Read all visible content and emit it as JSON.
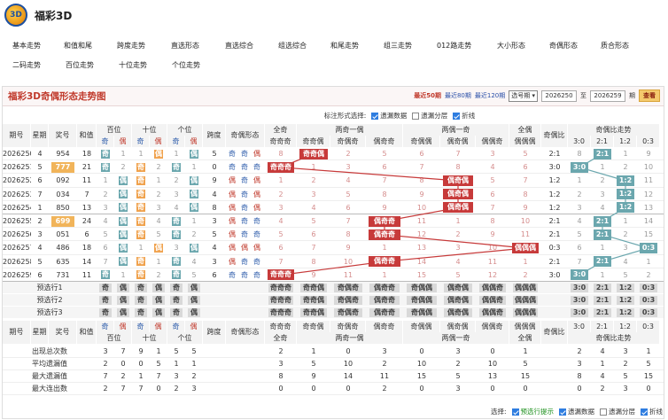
{
  "app": {
    "title": "福彩3D",
    "logo_text": "3D"
  },
  "nav": {
    "row1": [
      "基本走势",
      "和值和尾",
      "跨度走势",
      "直选形态",
      "直选综合",
      "组选综合",
      "和尾走势",
      "组三走势",
      "012路走势",
      "大小形态",
      "奇偶形态",
      "质合形态"
    ],
    "row2": [
      "二码走势",
      "百位走势",
      "十位走势",
      "个位走势"
    ]
  },
  "panel": {
    "title": "福彩3D奇偶形态走势图",
    "links": [
      "最近50期",
      "最近80期",
      "最近120期"
    ],
    "select": "选号期",
    "from": "2026250",
    "to_label": "至",
    "to": "2026259",
    "period_label": "期",
    "query": "查看"
  },
  "options": {
    "label": "标注形式选择:",
    "items": [
      {
        "label": "遗漏数据",
        "checked": true
      },
      {
        "label": "遗漏分层",
        "checked": false
      },
      {
        "label": "折线",
        "checked": true
      }
    ]
  },
  "headers": {
    "issue": "期号",
    "week": "星期",
    "prize": "奖号",
    "sum": "和值",
    "pos": [
      "百位",
      "十位",
      "个位"
    ],
    "span": "跨度",
    "shape": "奇偶形态",
    "groups": [
      "全奇",
      "两奇一偶",
      "两偶一奇",
      "全偶"
    ],
    "ratio": "奇偶比",
    "trend": "奇偶比走势"
  },
  "subheaders": {
    "oe": [
      "奇",
      "偶"
    ],
    "shape_cols": [
      "奇奇奇",
      "奇奇偶",
      "奇偶奇",
      "偶奇奇",
      "奇偶偶",
      "偶奇偶",
      "偶偶奇",
      "偶偶偶"
    ],
    "ratios": [
      "3:0",
      "2:1",
      "1:2",
      "0:3"
    ]
  },
  "rows": [
    {
      "issue": "2026250",
      "week": "4",
      "prize": "954",
      "sum": "18",
      "pos": [
        "奇",
        "1",
        "偶",
        "1",
        "偶",
        "1"
      ],
      "span": "5",
      "shape": [
        "奇",
        "奇",
        "偶"
      ],
      "cols": [
        "8",
        "奇奇偶",
        "2",
        "5",
        "6",
        "7",
        "3",
        "5"
      ],
      "ratio": "2:1",
      "trend": [
        "8",
        "2:1",
        "1",
        "9"
      ]
    },
    {
      "issue": "2026251",
      "week": "5",
      "prize": "777",
      "sum": "21",
      "pos": [
        "奇",
        "2",
        "奇",
        "2",
        "奇",
        "1"
      ],
      "span": "0",
      "shape": [
        "奇",
        "奇",
        "奇"
      ],
      "cols": [
        "奇奇奇",
        "1",
        "3",
        "6",
        "7",
        "8",
        "4",
        "6"
      ],
      "ratio": "3:0",
      "trend": [
        "3:0",
        "1",
        "2",
        "10"
      ]
    },
    {
      "issue": "2026252",
      "week": "6",
      "prize": "092",
      "sum": "11",
      "pos": [
        "偶",
        "1",
        "奇",
        "1",
        "偶",
        "2"
      ],
      "span": "9",
      "shape": [
        "偶",
        "奇",
        "偶"
      ],
      "cols": [
        "1",
        "2",
        "4",
        "7",
        "8",
        "偶奇偶",
        "5",
        "7"
      ],
      "ratio": "1:2",
      "trend": [
        "1",
        "2",
        "1:2",
        "11"
      ]
    },
    {
      "issue": "2026253",
      "week": "7",
      "prize": "034",
      "sum": "7",
      "pos": [
        "偶",
        "2",
        "奇",
        "2",
        "偶",
        "3"
      ],
      "span": "4",
      "shape": [
        "偶",
        "奇",
        "偶"
      ],
      "cols": [
        "2",
        "3",
        "5",
        "8",
        "9",
        "偶奇偶",
        "6",
        "8"
      ],
      "ratio": "1:2",
      "trend": [
        "2",
        "3",
        "1:2",
        "12"
      ]
    },
    {
      "issue": "2026254",
      "week": "1",
      "prize": "850",
      "sum": "13",
      "pos": [
        "偶",
        "3",
        "奇",
        "3",
        "偶",
        "4"
      ],
      "span": "8",
      "shape": [
        "偶",
        "奇",
        "偶"
      ],
      "cols": [
        "3",
        "4",
        "6",
        "9",
        "10",
        "偶奇偶",
        "7",
        "9"
      ],
      "ratio": "1:2",
      "trend": [
        "3",
        "4",
        "1:2",
        "13"
      ]
    },
    {
      "issue": "2026255",
      "week": "2",
      "prize": "699",
      "sum": "24",
      "pos": [
        "偶",
        "4",
        "奇",
        "4",
        "奇",
        "1"
      ],
      "span": "3",
      "shape": [
        "偶",
        "奇",
        "奇"
      ],
      "cols": [
        "4",
        "5",
        "7",
        "偶奇奇",
        "11",
        "1",
        "8",
        "10"
      ],
      "ratio": "2:1",
      "trend": [
        "4",
        "2:1",
        "1",
        "14"
      ]
    },
    {
      "issue": "2026256",
      "week": "3",
      "prize": "051",
      "sum": "6",
      "pos": [
        "偶",
        "5",
        "奇",
        "5",
        "奇",
        "2"
      ],
      "span": "5",
      "shape": [
        "偶",
        "奇",
        "奇"
      ],
      "cols": [
        "5",
        "6",
        "8",
        "偶奇奇",
        "12",
        "2",
        "9",
        "11"
      ],
      "ratio": "2:1",
      "trend": [
        "5",
        "2:1",
        "2",
        "15"
      ]
    },
    {
      "issue": "2026257",
      "week": "4",
      "prize": "486",
      "sum": "18",
      "pos": [
        "偶",
        "6",
        "偶",
        "1",
        "偶",
        "3"
      ],
      "span": "4",
      "shape": [
        "偶",
        "偶",
        "偶"
      ],
      "cols": [
        "6",
        "7",
        "9",
        "1",
        "13",
        "3",
        "10",
        "偶偶偶"
      ],
      "ratio": "0:3",
      "trend": [
        "6",
        "1",
        "3",
        "0:3"
      ]
    },
    {
      "issue": "2026258",
      "week": "5",
      "prize": "635",
      "sum": "14",
      "pos": [
        "偶",
        "7",
        "奇",
        "1",
        "奇",
        "4"
      ],
      "span": "3",
      "shape": [
        "偶",
        "奇",
        "奇"
      ],
      "cols": [
        "7",
        "8",
        "10",
        "偶奇奇",
        "14",
        "4",
        "11",
        "1"
      ],
      "ratio": "2:1",
      "trend": [
        "7",
        "2:1",
        "4",
        "1"
      ]
    },
    {
      "issue": "2026259",
      "week": "6",
      "prize": "731",
      "sum": "11",
      "pos": [
        "奇",
        "1",
        "奇",
        "2",
        "奇",
        "5"
      ],
      "span": "6",
      "shape": [
        "奇",
        "奇",
        "奇"
      ],
      "cols": [
        "奇奇奇",
        "9",
        "11",
        "1",
        "15",
        "5",
        "12",
        "2"
      ],
      "ratio": "3:0",
      "trend": [
        "3:0",
        "1",
        "5",
        "2"
      ]
    }
  ],
  "predict": {
    "labels": [
      "预选行1",
      "预选行2",
      "预选行3"
    ],
    "pos": [
      "奇",
      "偶",
      "奇",
      "偶",
      "奇",
      "偶"
    ],
    "cols": [
      "奇奇奇",
      "奇奇偶",
      "奇偶奇",
      "偶奇奇",
      "奇偶偶",
      "偶奇偶",
      "偶偶奇",
      "偶偶偶"
    ],
    "ratios": [
      "3:0",
      "2:1",
      "1:2",
      "0:3"
    ]
  },
  "footer_headers": {
    "issue": "期号",
    "week": "星期",
    "prize": "奖号",
    "sum": "和值",
    "pos": [
      "百位",
      "十位",
      "个位"
    ],
    "span": "跨度",
    "shape": "奇偶形态",
    "groups": [
      "全奇",
      "两奇一偶",
      "两偶一奇",
      "全偶"
    ],
    "ratio": "奇偶比",
    "trend": "奇偶比走势"
  },
  "stats": [
    {
      "label": "出现总次数",
      "pos": [
        "3",
        "7",
        "9",
        "1",
        "5",
        "5"
      ],
      "cols": [
        "2",
        "1",
        "0",
        "3",
        "0",
        "3",
        "0",
        "1"
      ],
      "trend": [
        "2",
        "4",
        "3",
        "1"
      ]
    },
    {
      "label": "平均遗漏值",
      "pos": [
        "2",
        "0",
        "0",
        "5",
        "1",
        "1"
      ],
      "cols": [
        "3",
        "5",
        "10",
        "2",
        "10",
        "2",
        "10",
        "5"
      ],
      "trend": [
        "3",
        "1",
        "2",
        "5"
      ]
    },
    {
      "label": "最大遗漏值",
      "pos": [
        "7",
        "2",
        "1",
        "7",
        "3",
        "2"
      ],
      "cols": [
        "8",
        "9",
        "14",
        "11",
        "15",
        "5",
        "13",
        "15"
      ],
      "trend": [
        "8",
        "4",
        "5",
        "15"
      ]
    },
    {
      "label": "最大连出数",
      "pos": [
        "2",
        "7",
        "7",
        "0",
        "2",
        "3"
      ],
      "cols": [
        "0",
        "0",
        "0",
        "2",
        "0",
        "3",
        "0",
        "0"
      ],
      "trend": [
        "0",
        "2",
        "3",
        "0"
      ]
    }
  ],
  "bottom": {
    "label": "选择:",
    "items": [
      {
        "label": "预选行提示",
        "checked": true
      },
      {
        "label": "遗漏数据",
        "checked": true
      },
      {
        "label": "遗漏分层",
        "checked": false
      },
      {
        "label": "折线",
        "checked": true
      }
    ]
  },
  "colors": {
    "accent": "#c0392b",
    "blue": "#5b97c4",
    "orange": "#f0a24d",
    "teal": "#6ba7ae"
  }
}
